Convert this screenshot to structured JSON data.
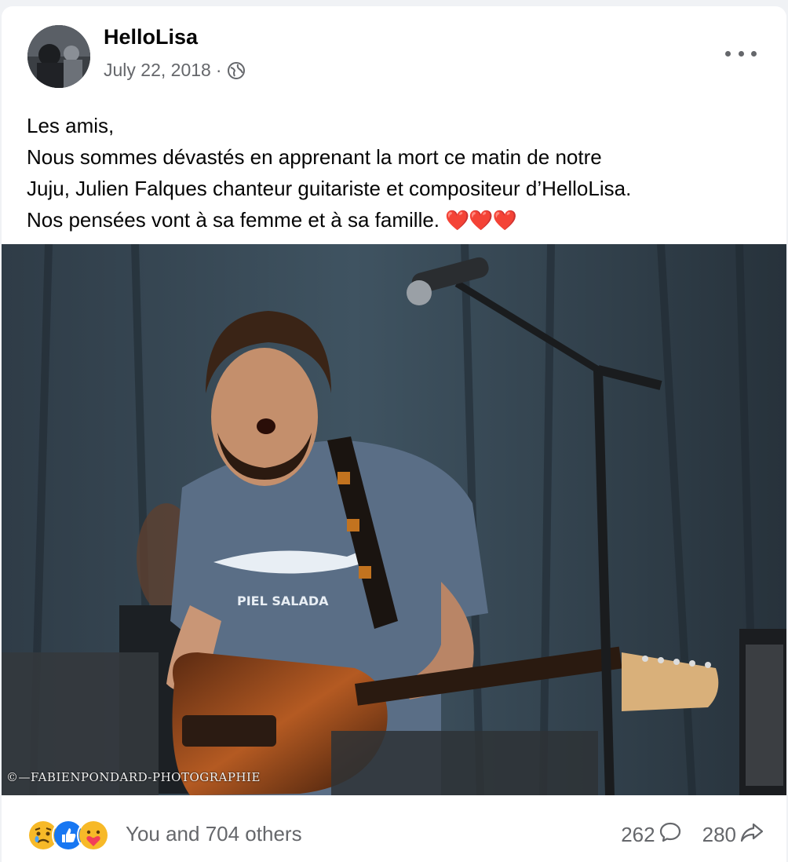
{
  "post": {
    "author": "HelloLisa",
    "date": "July 22, 2018",
    "separator": "·",
    "audience_icon": "globe-icon",
    "more_icon": "more-options-icon",
    "text_lines": [
      "Les amis,",
      "Nous sommes dévastés en apprenant la mort ce matin de notre",
      "Juju, Julien Falques chanteur guitariste et compositeur d’HelloLisa.",
      "Nos pensées vont à sa femme et à sa famille."
    ],
    "text_emoji": "❤️❤️❤️",
    "photo_watermark": "©—FABIENPONDARD-PHOTOGRAPHIE"
  },
  "footer": {
    "reaction_icons": [
      "sad-reaction-icon",
      "like-reaction-icon",
      "care-reaction-icon"
    ],
    "reaction_summary": "You and 704 others",
    "comments_count": "262",
    "comment_icon": "comment-icon",
    "shares_count": "280",
    "share_icon": "share-icon"
  },
  "colors": {
    "like_blue": "#1877f2",
    "reaction_yellow": "#f7b928",
    "heart_red": "#e0245e",
    "secondary_text": "#65676b"
  }
}
